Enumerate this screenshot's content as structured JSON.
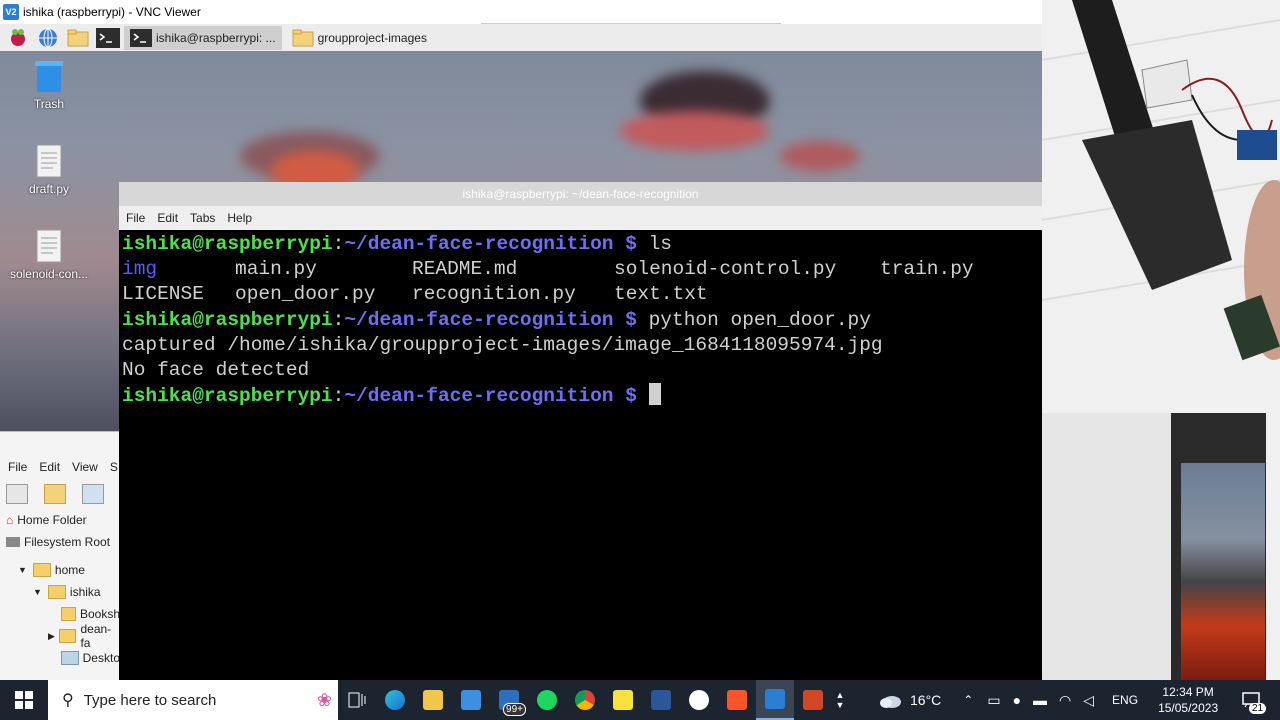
{
  "vnc": {
    "window_title": "ishika (raspberrypi) - VNC Viewer",
    "app_badge": "V2"
  },
  "pi_panel": {
    "tasks": [
      {
        "label": "ishika@raspberrypi: ..."
      },
      {
        "label": "groupproject-images"
      }
    ]
  },
  "desktop": {
    "icons": [
      {
        "label": "Trash",
        "icon": "trash-icon"
      },
      {
        "label": "draft.py",
        "icon": "file-icon"
      },
      {
        "label": "solenoid-con...",
        "icon": "file-icon"
      }
    ]
  },
  "terminal": {
    "title": "ishika@raspberrypi: ~/dean-face-recognition",
    "menu": [
      "File",
      "Edit",
      "Tabs",
      "Help"
    ],
    "prompt_user": "ishika@raspberrypi",
    "prompt_sep": ":",
    "prompt_path": "~/dean-face-recognition",
    "prompt_dollar": "$",
    "cmd1": " ls",
    "ls_row1": [
      "img",
      "main.py",
      "README.md",
      "solenoid-control.py",
      "train.py"
    ],
    "ls_row2": [
      "LICENSE",
      "open_door.py",
      "recognition.py",
      "text.txt"
    ],
    "cmd2": " python open_door.py",
    "out1": "captured /home/ishika/groupproject-images/image_1684118095974.jpg",
    "out2": "No face detected"
  },
  "file_manager": {
    "menu": [
      "File",
      "Edit",
      "View",
      "S"
    ],
    "places": [
      {
        "label": "Home Folder",
        "icon": "home-icon"
      },
      {
        "label": "Filesystem Root",
        "icon": "drive-icon"
      }
    ],
    "tree": [
      {
        "label": "home",
        "expanded": true,
        "depth": 0
      },
      {
        "label": "ishika",
        "expanded": true,
        "depth": 1
      },
      {
        "label": "Booksh",
        "depth": 2
      },
      {
        "label": "dean-fa",
        "depth": 2
      },
      {
        "label": "Deskto",
        "depth": 2
      }
    ]
  },
  "taskbar": {
    "search_placeholder": "Type here to search",
    "mail_badge": "99+",
    "weather": "16°C",
    "language": "ENG",
    "time": "12:34 PM",
    "date": "15/05/2023",
    "notifications": "21"
  }
}
